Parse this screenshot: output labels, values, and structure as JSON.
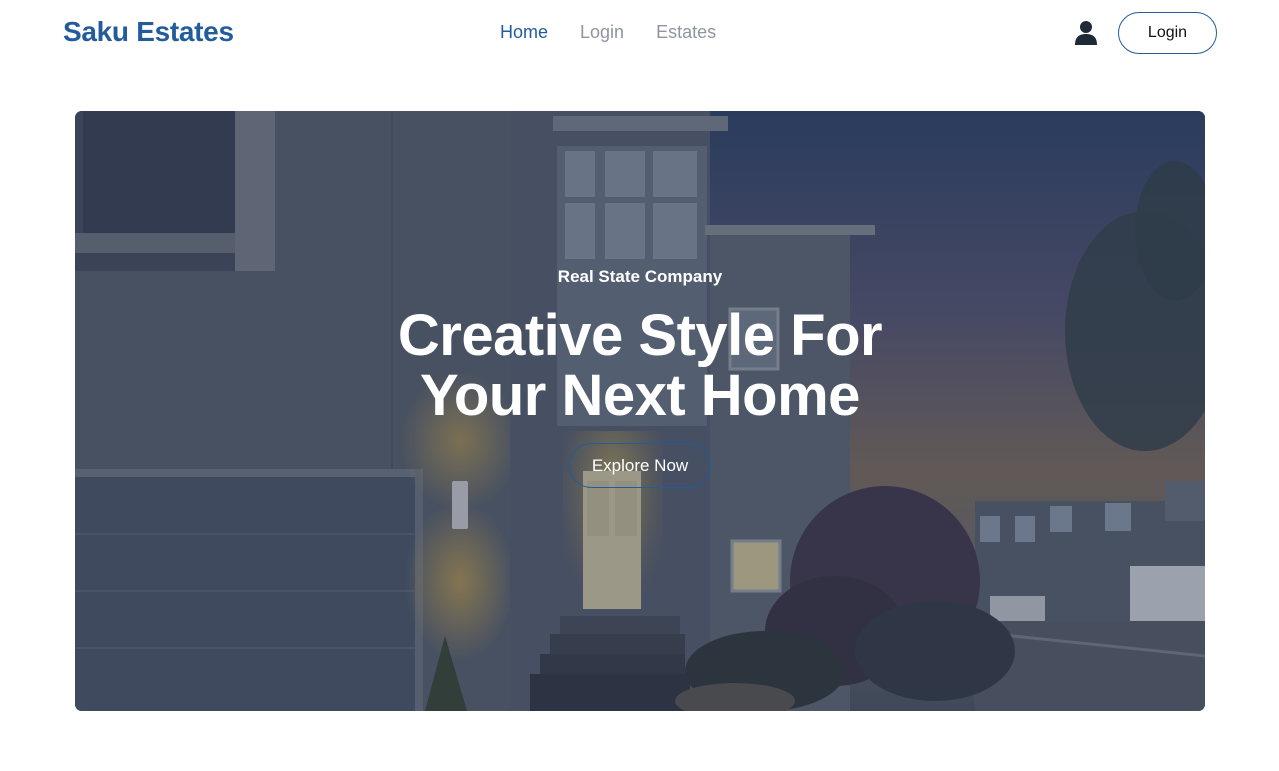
{
  "brand": {
    "name": "Saku Estates",
    "color": "#235c9a"
  },
  "nav": {
    "links": [
      {
        "label": "Home",
        "active": true
      },
      {
        "label": "Login",
        "active": false
      },
      {
        "label": "Estates",
        "active": false
      }
    ],
    "user_icon": "user-icon",
    "login_button": "Login"
  },
  "hero": {
    "subtitle": "Real State Company",
    "title_line1": "Creative Style For",
    "title_line2": "Your Next Home",
    "cta_label": "Explore Now"
  },
  "colors": {
    "accent": "#235c9a",
    "nav_inactive": "#8e959f",
    "hero_text": "#ffffff"
  }
}
